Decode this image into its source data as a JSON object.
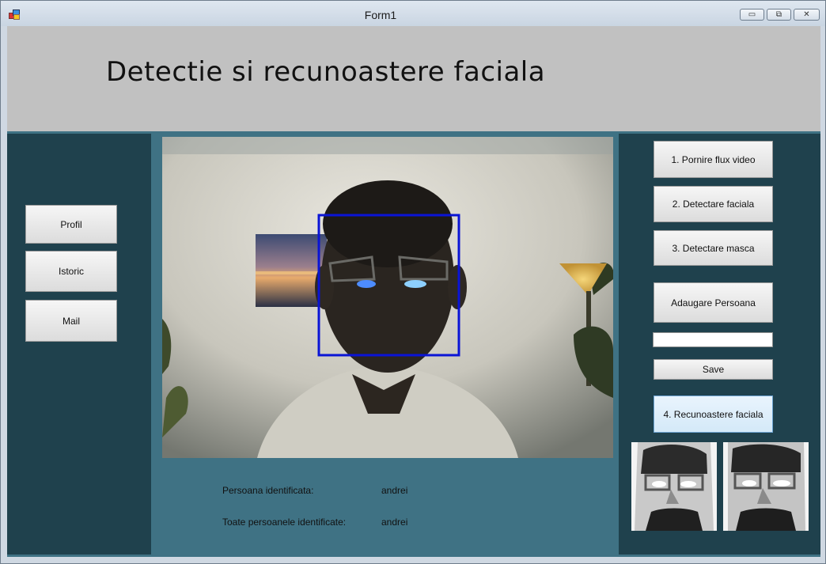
{
  "window": {
    "title": "Form1",
    "controls": {
      "minimize": "▭",
      "maximize": "⧉",
      "close": "✕"
    }
  },
  "header": {
    "title": "Detectie si recunoastere faciala"
  },
  "left_menu": {
    "profile_label": "Profil",
    "history_label": "Istoric",
    "mail_label": "Mail"
  },
  "right_menu": {
    "start_video_label": "1. Pornire flux video",
    "face_detection_label": "2. Detectare faciala",
    "mask_detection_label": "3. Detectare masca",
    "add_person_label": "Adaugare Persoana",
    "name_input_value": "",
    "save_label": "Save",
    "face_recognition_label": "4. Recunoastere faciala"
  },
  "results": {
    "identified_label": "Persoana identificata:",
    "identified_value": "andrei",
    "all_identified_label": "Toate persoanele identificate:",
    "all_identified_value": "andrei"
  },
  "colors": {
    "panel_dark": "#1f414d",
    "panel_mid": "#3f7284",
    "header_gray": "#c1c1c1",
    "face_box": "#0a14d6"
  }
}
